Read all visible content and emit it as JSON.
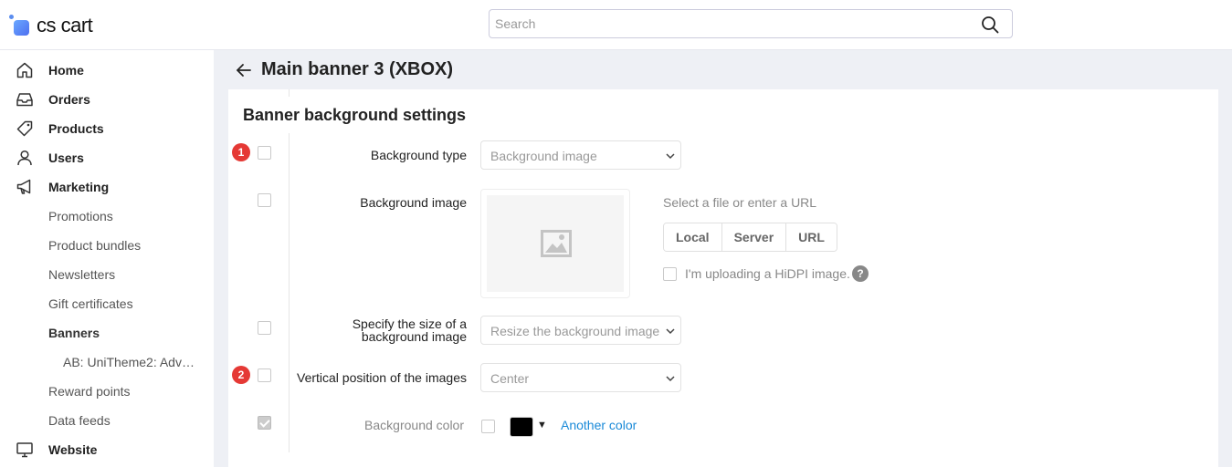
{
  "app": {
    "logo_text": "cs cart"
  },
  "search": {
    "placeholder": "Search",
    "icon": "search-icon"
  },
  "sidebar": {
    "items": [
      {
        "label": "Home",
        "icon": "home-icon"
      },
      {
        "label": "Orders",
        "icon": "inbox-icon"
      },
      {
        "label": "Products",
        "icon": "tag-icon"
      },
      {
        "label": "Users",
        "icon": "user-icon"
      },
      {
        "label": "Marketing",
        "icon": "megaphone-icon"
      },
      {
        "label": "Promotions"
      },
      {
        "label": "Product bundles"
      },
      {
        "label": "Newsletters"
      },
      {
        "label": "Gift certificates"
      },
      {
        "label": "Banners"
      },
      {
        "label": "AB: UniTheme2: Advan..."
      },
      {
        "label": "Reward points"
      },
      {
        "label": "Data feeds"
      },
      {
        "label": "Website",
        "icon": "monitor-icon"
      }
    ]
  },
  "page": {
    "title": "Main banner 3 (XBOX)"
  },
  "section": {
    "title": "Banner background settings"
  },
  "fields": {
    "background_type": {
      "badge": "1",
      "label": "Background type",
      "value": "Background image"
    },
    "background_image": {
      "label": "Background image",
      "hint": "Select a file or enter a URL",
      "buttons": [
        "Local",
        "Server",
        "URL"
      ],
      "hidpi_label": "I'm uploading a HiDPI image.",
      "help": "?"
    },
    "bg_size": {
      "label_line1": "Specify the size of a",
      "label_line2": "background image",
      "value": "Resize the background image"
    },
    "vertical_position": {
      "badge": "2",
      "label": "Vertical position of the images",
      "value": "Center"
    },
    "background_color": {
      "label": "Background color",
      "color": "#000000",
      "caret": "▼",
      "link": "Another color"
    }
  }
}
